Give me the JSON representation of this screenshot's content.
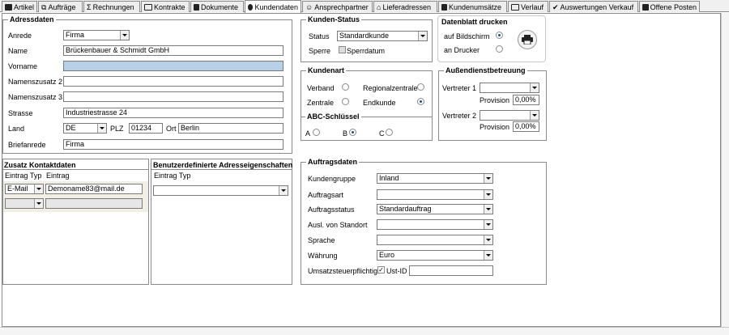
{
  "tabs": [
    {
      "label": "Artikel",
      "icon": "box-icon"
    },
    {
      "label": "Aufträge",
      "icon": "orders-icon"
    },
    {
      "label": "Rechnungen",
      "icon": "sigma-icon"
    },
    {
      "label": "Kontrakte",
      "icon": "contract-icon"
    },
    {
      "label": "Dokumente",
      "icon": "document-icon"
    },
    {
      "label": "Kundendaten",
      "icon": "info-icon"
    },
    {
      "label": "Ansprechpartner",
      "icon": "contacts-icon"
    },
    {
      "label": "Lieferadressen",
      "icon": "house-icon"
    },
    {
      "label": "Kundenumsätze",
      "icon": "calculator-icon"
    },
    {
      "label": "Verlauf",
      "icon": "film-icon"
    },
    {
      "label": "Auswertungen Verkauf",
      "icon": "check-icon"
    },
    {
      "label": "Offene Posten",
      "icon": "books-icon"
    }
  ],
  "adressdaten": {
    "title": "Adressdaten",
    "anrede_label": "Anrede",
    "anrede_value": "Firma",
    "name_label": "Name",
    "name_value": "Brückenbauer & Schmidt GmbH",
    "vorname_label": "Vorname",
    "vorname_value": "",
    "nz2_label": "Namenszusatz 2",
    "nz2_value": "",
    "nz3_label": "Namenszusatz 3",
    "nz3_value": "",
    "strasse_label": "Strasse",
    "strasse_value": "Industriestrasse 24",
    "land_label": "Land",
    "land_value": "DE",
    "plz_label": "PLZ",
    "plz_value": "01234",
    "ort_label": "Ort",
    "ort_value": "Berlin",
    "briefanrede_label": "Briefanrede",
    "briefanrede_value": "Firma"
  },
  "kundenstatus": {
    "title": "Kunden-Status",
    "status_label": "Status",
    "status_value": "Standardkunde",
    "sperre_label": "Sperre",
    "sperrdatum_label": "Sperrdatum"
  },
  "datenblatt": {
    "title": "Datenblatt drucken",
    "bildschirm_label": "auf Bildschirm",
    "drucker_label": "an Drucker"
  },
  "kundenart": {
    "title": "Kundenart",
    "verband": "Verband",
    "regionalzentrale": "Regionalzentrale",
    "zentrale": "Zentrale",
    "endkunde": "Endkunde",
    "abc_title": "ABC-Schlüssel",
    "a": "A",
    "b": "B",
    "c": "C"
  },
  "aussendienst": {
    "title": "Außendienstbetreuung",
    "v1_label": "Vertreter 1",
    "v1_value": "",
    "prov1_label": "Provision",
    "prov1_value": "0,00%",
    "v2_label": "Vertreter 2",
    "v2_value": "",
    "prov2_label": "Provision",
    "prov2_value": "0,00%"
  },
  "zusatz": {
    "title": "Zusatz Kontaktdaten",
    "col1": "Eintrag Typ",
    "col2": "Eintrag",
    "row1_type": "E-Mail",
    "row1_value": "Demoname83@mail.de"
  },
  "benutzer": {
    "title": "Benutzerdefinierte Adresseigenschaften",
    "col1": "Eintrag Typ"
  },
  "auftragsdaten": {
    "title": "Auftragsdaten",
    "kundengruppe_label": "Kundengruppe",
    "kundengruppe_value": "Inland",
    "auftragsart_label": "Auftragsart",
    "auftragsart_value": "",
    "auftragsstatus_label": "Auftragsstatus",
    "auftragsstatus_value": "Standardauftrag",
    "ausl_label": "Ausl. von Standort",
    "ausl_value": "",
    "sprache_label": "Sprache",
    "sprache_value": "",
    "waehrung_label": "Währung",
    "waehrung_value": "Euro",
    "ust_label": "Umsatzsteuerpflichtig",
    "ustid_label": "Ust-ID",
    "ustid_value": ""
  }
}
